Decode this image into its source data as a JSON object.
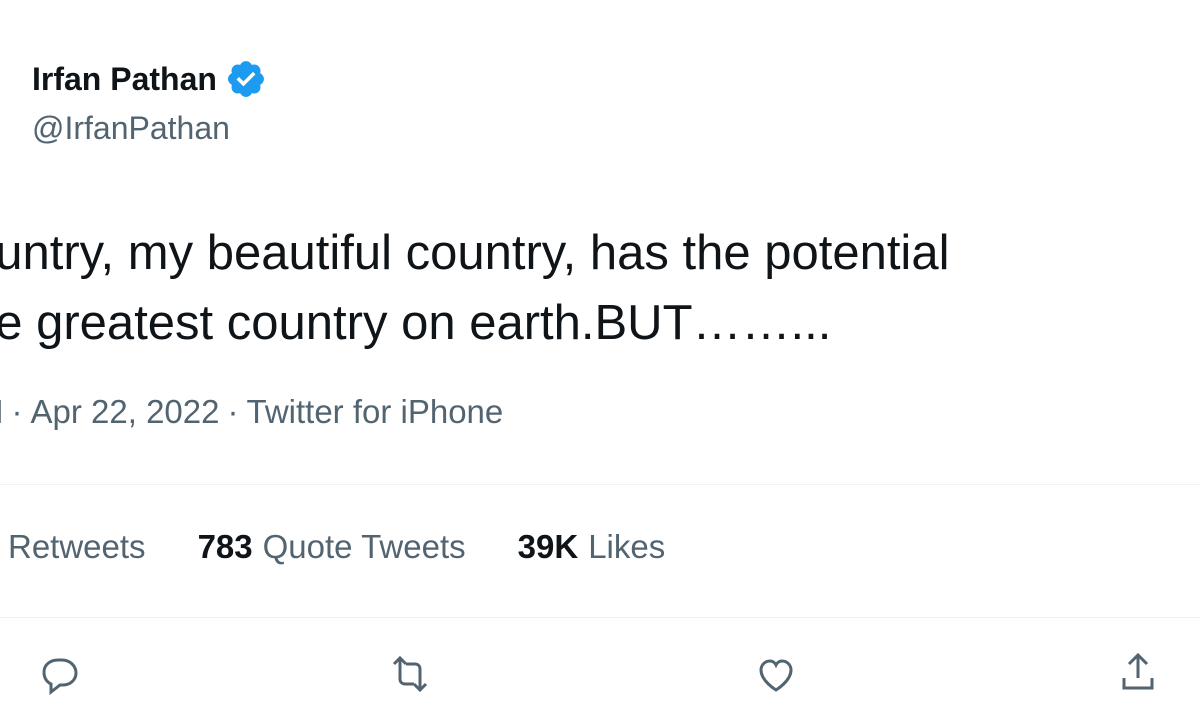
{
  "author": {
    "display_name": "Irfan Pathan",
    "handle": "@IrfanPathan",
    "verified_icon": "verified-badge-icon"
  },
  "tweet": {
    "text_line_1": "ountry, my beautiful country, has the potential",
    "text_line_2": "he greatest country on earth.BUT……..."
  },
  "meta": {
    "time": "M",
    "date": "Apr 22, 2022",
    "source": "Twitter for iPhone",
    "separator": "·"
  },
  "stats": {
    "retweets_label": "Retweets",
    "quote_count": "783",
    "quote_label": "Quote Tweets",
    "likes_count": "39K",
    "likes_label": "Likes"
  },
  "actions": {
    "reply_icon": "reply-icon",
    "retweet_icon": "retweet-icon",
    "like_icon": "heart-icon",
    "share_icon": "share-icon"
  },
  "colors": {
    "text_primary": "#0f1419",
    "text_secondary": "#536471",
    "verified": "#1d9bf0",
    "divider": "#eff3f4"
  }
}
